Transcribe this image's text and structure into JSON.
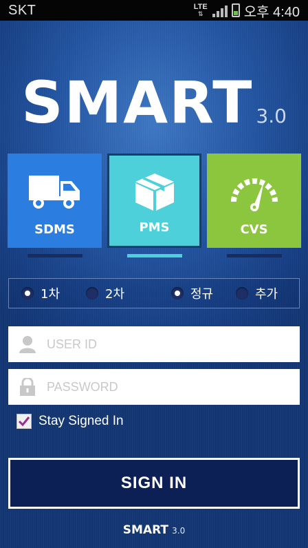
{
  "status_bar": {
    "carrier": "SKT",
    "network": "LTE",
    "clock": "오후 4:40"
  },
  "logo": {
    "main": "SMART",
    "version": "3.0"
  },
  "tiles": [
    {
      "label": "SDMS",
      "icon": "truck-icon",
      "color": "#2b7de0",
      "selected": false
    },
    {
      "label": "PMS",
      "icon": "package-box-icon",
      "color": "#4dd0d9",
      "selected": true
    },
    {
      "label": "CVS",
      "icon": "speedometer-icon",
      "color": "#8cc63e",
      "selected": false
    }
  ],
  "radios": [
    {
      "label": "1차",
      "checked": true
    },
    {
      "label": "2차",
      "checked": false
    },
    {
      "label": "정규",
      "checked": true
    },
    {
      "label": "추가",
      "checked": false
    }
  ],
  "form": {
    "user_placeholder": "USER ID",
    "user_value": "",
    "password_placeholder": "PASSWORD",
    "password_value": "",
    "stay_signed_in_label": "Stay Signed In",
    "stay_signed_in_checked": true,
    "sign_in_label": "SIGN IN"
  },
  "footer": {
    "main": "SMART",
    "version": "3.0"
  }
}
